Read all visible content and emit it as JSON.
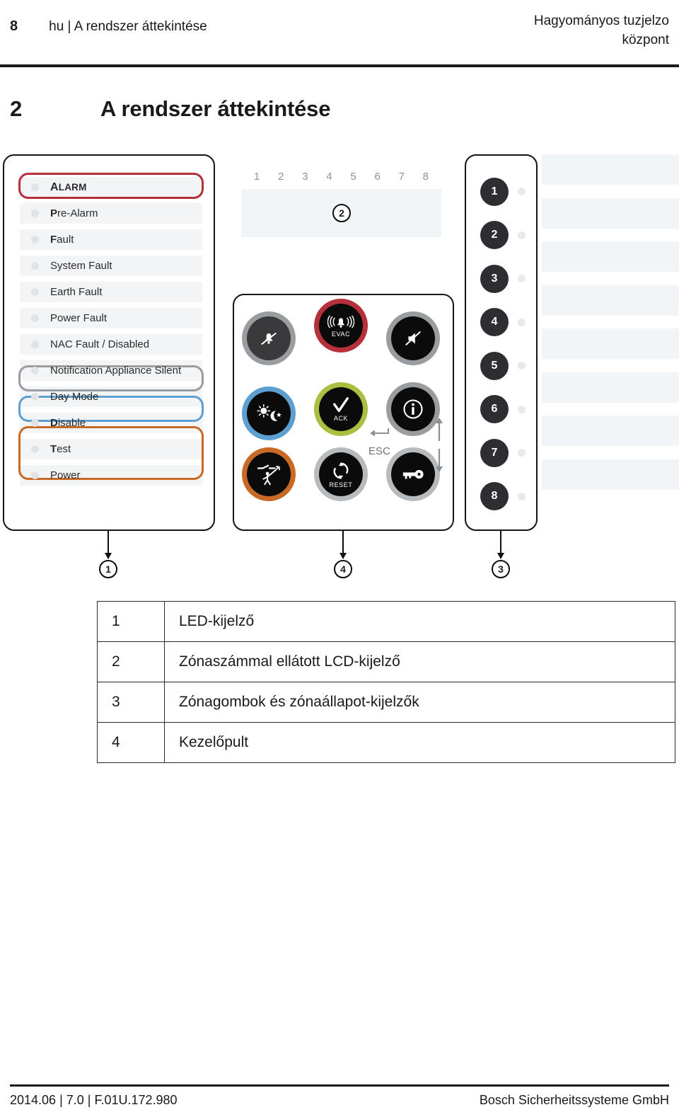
{
  "header": {
    "page_number": "8",
    "breadcrumb": "hu | A rendszer áttekintése",
    "product_line1": "Hagyományos tuzjelzo",
    "product_line2": "központ"
  },
  "title": {
    "number": "2",
    "text": "A rendszer áttekintése"
  },
  "figure": {
    "led_panel": {
      "rows": [
        {
          "bold_prefix": "A",
          "rest": "LARM",
          "style": "caps",
          "highlight": "alarm"
        },
        {
          "bold_prefix": "P",
          "rest": "re-Alarm",
          "style": "normal",
          "highlight": null
        },
        {
          "bold_prefix": "F",
          "rest": "ault",
          "style": "normal",
          "highlight": null
        },
        {
          "bold_prefix": "",
          "rest": "System Fault",
          "style": "normal",
          "highlight": null
        },
        {
          "bold_prefix": "",
          "rest": "Earth Fault",
          "style": "normal",
          "highlight": null
        },
        {
          "bold_prefix": "",
          "rest": "Power Fault",
          "style": "normal",
          "highlight": null
        },
        {
          "bold_prefix": "",
          "rest": "NAC Fault / Disabled",
          "style": "normal",
          "highlight": null
        },
        {
          "bold_prefix": "",
          "rest": "Notification Appliance Silent",
          "style": "normal",
          "highlight": "silent"
        },
        {
          "bold_prefix": "",
          "rest": "Day Mode",
          "style": "normal",
          "highlight": "daymode"
        },
        {
          "bold_prefix": "D",
          "rest": "isable",
          "style": "normal",
          "highlight": "disable-test"
        },
        {
          "bold_prefix": "T",
          "rest": "est",
          "style": "normal",
          "highlight": "disable-test"
        },
        {
          "bold_prefix": "",
          "rest": "Power",
          "style": "normal",
          "highlight": null
        }
      ],
      "highlight_colors": {
        "alarm": "#b5303a",
        "silent": "#9a9d9f",
        "daymode": "#5c9fd0",
        "disable_test": "#c86a26"
      }
    },
    "lcd": {
      "zone_numbers": [
        "1",
        "2",
        "3",
        "4",
        "5",
        "6",
        "7",
        "8"
      ],
      "callout": "2"
    },
    "keypad": {
      "buttons": [
        {
          "id": "alarm-silence",
          "icon": "bell-crossed-icon",
          "label": "",
          "ring": "#9a9d9f",
          "face": "#3a3a3c"
        },
        {
          "id": "evac",
          "icon": "bell-ringing-icon",
          "label": "EVAC",
          "ring": "#b5303a",
          "face": "#0b0b0b"
        },
        {
          "id": "sounder-silence",
          "icon": "horn-crossed-icon",
          "label": "",
          "ring": "#9a9d9f",
          "face": "#0b0b0b"
        },
        {
          "id": "day-night-mode",
          "icon": "sun-moon-icon",
          "label": "",
          "ring": "#5c9fd0",
          "face": "#0b0b0b"
        },
        {
          "id": "ack",
          "icon": "check-icon",
          "label": "ACK",
          "ring": "#a8bf3f",
          "face": "#0b0b0b"
        },
        {
          "id": "info",
          "icon": "info-icon",
          "label": "",
          "ring": "#9a9d9f",
          "face": "#0b0b0b"
        },
        {
          "id": "disable-isolate",
          "icon": "isolate-person-icon",
          "label": "",
          "ring": "#c86a26",
          "face": "#0b0b0b"
        },
        {
          "id": "reset",
          "icon": "reset-arrows-icon",
          "label": "RESET",
          "ring": "#b8bbbd",
          "face": "#0b0b0b"
        },
        {
          "id": "key-access",
          "icon": "key-icon",
          "label": "",
          "ring": "#b8bbbd",
          "face": "#0b0b0b"
        }
      ],
      "esc_label": "ESC",
      "enter_icon": "enter-arrow-icon",
      "up_icon": "arrow-up-icon",
      "down_icon": "arrow-down-icon"
    },
    "zone_panel": {
      "zones": [
        "1",
        "2",
        "3",
        "4",
        "5",
        "6",
        "7",
        "8"
      ]
    },
    "callouts": [
      {
        "number": "1",
        "target": "led-panel"
      },
      {
        "number": "4",
        "target": "keypad"
      },
      {
        "number": "3",
        "target": "zone-panel"
      }
    ]
  },
  "legend": {
    "rows": [
      {
        "num": "1",
        "desc": "LED-kijelző"
      },
      {
        "num": "2",
        "desc": "Zónaszámmal ellátott LCD-kijelző"
      },
      {
        "num": "3",
        "desc": "Zónagombok és zónaállapot-kijelzők"
      },
      {
        "num": "4",
        "desc": "Kezelőpult"
      }
    ]
  },
  "footer": {
    "left": "2014.06 | 7.0 | F.01U.172.980",
    "right": "Bosch Sicherheitssysteme GmbH"
  }
}
